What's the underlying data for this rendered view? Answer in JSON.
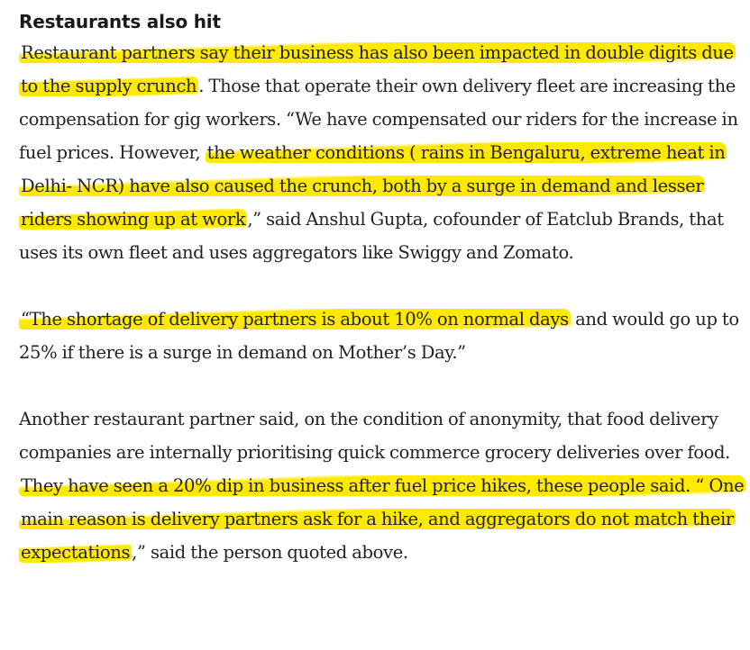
{
  "article": {
    "heading": "Restaurants also hit",
    "paragraphs": [
      {
        "segments": [
          {
            "text": "Restaurant partners say their business has also been impacted in double digits due to the supply crunch",
            "highlight": true
          },
          {
            "text": ". Those that operate their own delivery fleet are increasing the compensation for gig workers. “We have compensated our riders for the increase in fuel prices. However, ",
            "highlight": false
          },
          {
            "text": "the weather conditions ( rains in Bengaluru, extreme heat in Delhi- NCR) have also caused the crunch, both by a surge in demand and lesser riders showing up at work",
            "highlight": true
          },
          {
            "text": ",” said Anshul Gupta, cofounder of Eatclub Brands, that uses its own fleet and uses aggregators like Swiggy and Zomato.",
            "highlight": false
          }
        ]
      },
      {
        "segments": [
          {
            "text": "“The shortage of delivery partners is about 10% on normal days",
            "highlight": true
          },
          {
            "text": " and would go up to 25% if there is a surge in demand on Mother’s Day.”",
            "highlight": false
          }
        ]
      },
      {
        "segments": [
          {
            "text": "Another restaurant partner said, on the condition of anonymity, that food delivery companies are internally prioritising quick commerce grocery deliveries over food. ",
            "highlight": false
          },
          {
            "text": "They have seen a 20% dip in business after fuel price hikes, these people said. “ One main reason is delivery partners ask for a hike, and aggregators do not match their expectations",
            "highlight": true
          },
          {
            "text": ",” said the person quoted above.",
            "highlight": false
          }
        ]
      }
    ],
    "highlight_color": "#ffe900",
    "text_color": "#222222"
  }
}
